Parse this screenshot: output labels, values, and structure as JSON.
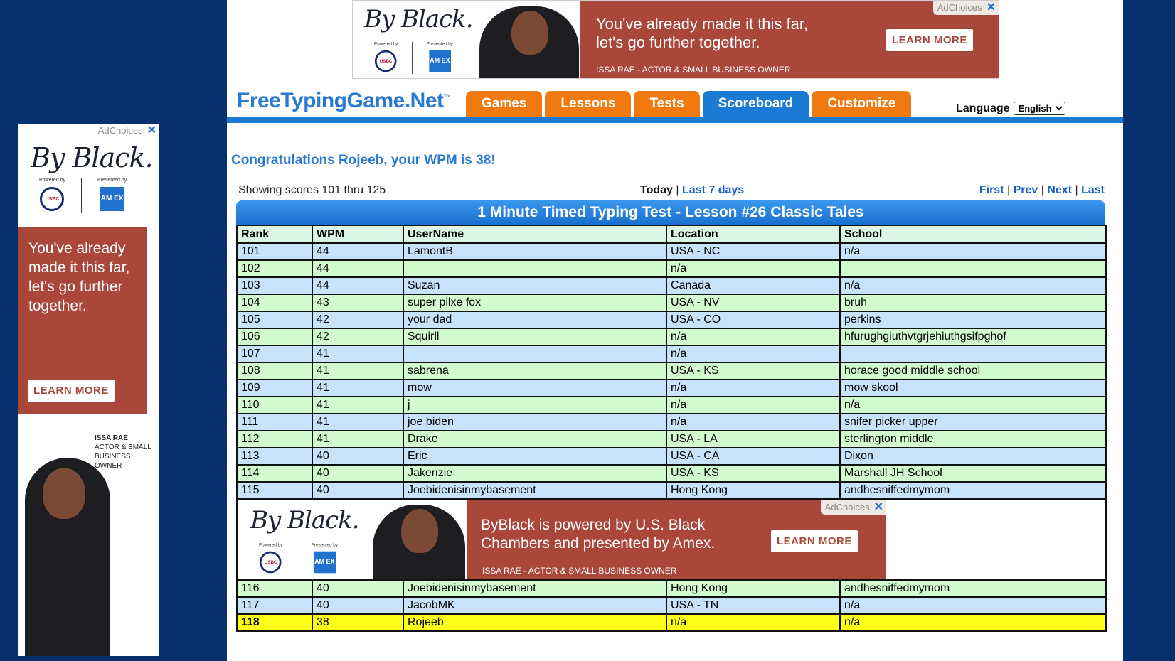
{
  "side_ad": {
    "adchoices": "AdChoices",
    "close": "✕",
    "brand": "By Black.",
    "powered_by": "Powered by",
    "presented_by": "Presented by",
    "usbc": "USBC",
    "amex": "AM EX",
    "message": "You've already made it this far, let's go further together.",
    "cta": "LEARN MORE",
    "caption_name": "ISSA RAE",
    "caption_role": "ACTOR & SMALL BUSINESS OWNER"
  },
  "top_ad": {
    "adchoices": "AdChoices",
    "close": "✕",
    "brand": "By Black.",
    "powered_by": "Powered by",
    "presented_by": "Presented by",
    "usbc": "USBC",
    "amex": "AM EX",
    "message_line1": "You've already made it this far,",
    "message_line2": "let's go further together.",
    "cta": "LEARN MORE",
    "caption": "ISSA RAE - ACTOR & SMALL BUSINESS OWNER"
  },
  "header": {
    "logo": "FreeTypingGame.Net",
    "tm": "™",
    "tabs": [
      "Games",
      "Lessons",
      "Tests",
      "Scoreboard",
      "Customize"
    ],
    "active_tab": "Scoreboard",
    "language_label": "Language",
    "language_value": "English"
  },
  "congrats": "Congratulations Rojeeb, your WPM is 38!",
  "showing": "Showing scores 101 thru 125",
  "periods": {
    "today": "Today",
    "sep": "|",
    "last7": "Last 7 days"
  },
  "pager": {
    "first": "First",
    "prev": "Prev",
    "next": "Next",
    "last": "Last",
    "sep": "|"
  },
  "board_title": "1 Minute Timed Typing Test - Lesson #26 Classic Tales",
  "columns": [
    "Rank",
    "WPM",
    "UserName",
    "Location",
    "School"
  ],
  "rows_before_ad": [
    [
      "101",
      "44",
      "LamontB",
      "USA - NC",
      "n/a"
    ],
    [
      "102",
      "44",
      "",
      "n/a",
      ""
    ],
    [
      "103",
      "44",
      "Suzan",
      "Canada",
      "n/a"
    ],
    [
      "104",
      "43",
      "super pilxe fox",
      "USA - NV",
      "bruh"
    ],
    [
      "105",
      "42",
      "your dad",
      "USA - CO",
      "perkins"
    ],
    [
      "106",
      "42",
      "Squirll",
      "n/a",
      "hfurughgiuthvtgrjehiuthgsifpghof"
    ],
    [
      "107",
      "41",
      "",
      "n/a",
      ""
    ],
    [
      "108",
      "41",
      "sabrena",
      "USA - KS",
      "horace good middle school"
    ],
    [
      "109",
      "41",
      "mow",
      "n/a",
      "mow skool"
    ],
    [
      "110",
      "41",
      "j",
      "n/a",
      "n/a"
    ],
    [
      "111",
      "41",
      "joe biden",
      "n/a",
      "snifer picker upper"
    ],
    [
      "112",
      "41",
      "Drake",
      "USA - LA",
      "sterlington middle"
    ],
    [
      "113",
      "40",
      "Eric",
      "USA - CA",
      "Dixon"
    ],
    [
      "114",
      "40",
      "Jakenzie",
      "USA - KS",
      "Marshall JH School"
    ],
    [
      "115",
      "40",
      "Joebidenisinmybasement",
      "Hong Kong",
      "andhesniffedmymom"
    ]
  ],
  "inline_ad": {
    "adchoices": "AdChoices",
    "close": "✕",
    "brand": "By Black.",
    "powered_by": "Powered by",
    "presented_by": "Presented by",
    "usbc": "USBC",
    "amex": "AM EX",
    "message_line1": "ByBlack is powered by U.S. Black",
    "message_line2": "Chambers and presented by Amex.",
    "cta": "LEARN MORE",
    "caption": "ISSA RAE - ACTOR & SMALL BUSINESS OWNER"
  },
  "rows_after_ad": [
    [
      "116",
      "40",
      "Joebidenisinmybasement",
      "Hong Kong",
      "andhesniffedmymom"
    ],
    [
      "117",
      "40",
      "JacobMK",
      "USA - TN",
      "n/a"
    ],
    [
      "118",
      "38",
      "Rojeeb",
      "n/a",
      "n/a"
    ]
  ],
  "highlight_rank": "118",
  "colors": {
    "page_bg": "#06306e",
    "accent_blue": "#1a7ad4",
    "tab_orange": "#f07a10",
    "row_blue": "#c9e2fb",
    "row_green": "#d2fbd0",
    "row_highlight": "#ffff1a",
    "ad_red": "#a8473a"
  }
}
